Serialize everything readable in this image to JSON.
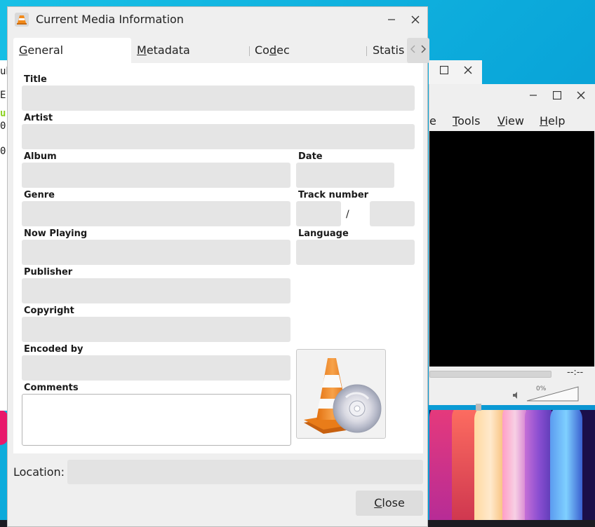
{
  "dialog": {
    "title": "Current Media Information",
    "tabs": [
      {
        "label": "General",
        "accel": "G",
        "rest": "eneral",
        "active": true
      },
      {
        "label": "Metadata",
        "accel": "M",
        "rest": "etadata",
        "active": false
      },
      {
        "label": "Codec",
        "accel": "d",
        "pre": "Co",
        "rest": "ec",
        "active": false
      },
      {
        "label": "Statis",
        "active": false
      }
    ],
    "fields": {
      "title": {
        "label": "Title",
        "value": ""
      },
      "artist": {
        "label": "Artist",
        "value": ""
      },
      "album": {
        "label": "Album",
        "value": ""
      },
      "date": {
        "label": "Date",
        "value": ""
      },
      "genre": {
        "label": "Genre",
        "value": ""
      },
      "track_number": {
        "label": "Track number",
        "value": "",
        "total": "",
        "separator": "/"
      },
      "now_playing": {
        "label": "Now Playing",
        "value": ""
      },
      "language": {
        "label": "Language",
        "value": ""
      },
      "publisher": {
        "label": "Publisher",
        "value": ""
      },
      "copyright": {
        "label": "Copyright",
        "value": ""
      },
      "encoded_by": {
        "label": "Encoded by",
        "value": ""
      },
      "comments": {
        "label": "Comments",
        "value": ""
      }
    },
    "location": {
      "label": "Location:",
      "value": ""
    },
    "close_button": {
      "accel": "C",
      "rest": "lose",
      "label": "Close"
    }
  },
  "vlc_main": {
    "menus": [
      {
        "label": "e"
      },
      {
        "accel": "T",
        "rest": "ools",
        "label": "Tools"
      },
      {
        "accel": "V",
        "rest": "iew",
        "label": "View"
      },
      {
        "accel": "H",
        "rest": "elp",
        "label": "Help"
      }
    ],
    "time": "--:--",
    "volume": {
      "percent_label": "0%",
      "level": 0
    }
  },
  "terminal": {
    "lines": [
      "ub",
      "E",
      "u",
      "0",
      "0"
    ]
  },
  "colors": {
    "desktop": "#13b5dd",
    "dialog_bg": "#efefef",
    "field_bg": "#e5e5e5",
    "panel_bg": "#ffffff",
    "vlc_orange": "#f28a1a"
  },
  "icons": [
    "vlc-cone-icon",
    "minimize-icon",
    "close-icon",
    "maximize-icon",
    "tab-scroll-left-icon",
    "tab-scroll-right-icon",
    "speaker-icon",
    "album-art-cone-cd-icon"
  ]
}
